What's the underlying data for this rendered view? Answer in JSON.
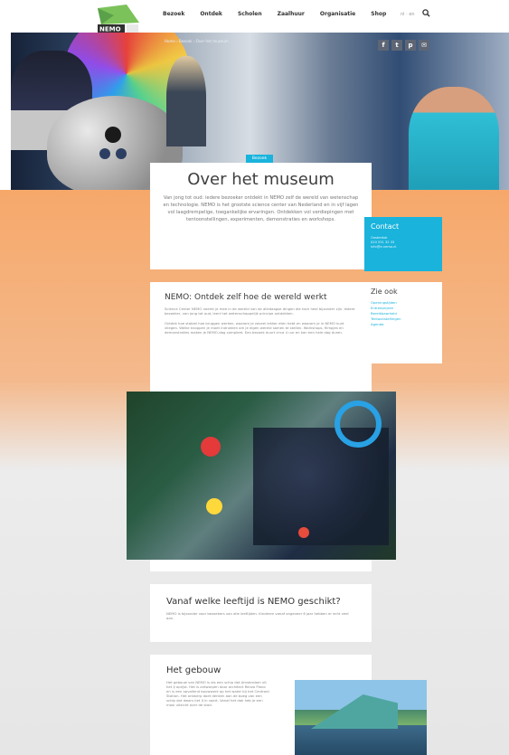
{
  "header": {
    "logo_text": "NEMO",
    "nav": [
      "Bezoek",
      "Ontdek",
      "Scholen",
      "Zaalhuur",
      "Organisatie",
      "Shop"
    ],
    "lang": "nl · en"
  },
  "hero": {
    "breadcrumb": "Home › Bezoek › Over het museum",
    "social": [
      "f",
      "t",
      "p",
      "✉"
    ]
  },
  "intro": {
    "tag": "Bezoek",
    "title": "Over het museum",
    "text": "Van jong tot oud: iedere bezoeker ontdekt in NEMO zelf de wereld van wetenschap en technologie. NEMO is het grootste science center van Nederland en in vijf lagen vol laagdrempelige, toegankelijke ervaringen. Ontdekken vol verdiepingen met tentoonstellingen, experimenten, demonstraties en workshops."
  },
  "contact": {
    "title": "Contact",
    "lines": [
      "Oosterdok",
      "020 531 32 33",
      "info@e-nemo.nl"
    ]
  },
  "zie_ook": {
    "title": "Zie ook",
    "items": [
      "Openingstijden",
      "Entreeprijzen",
      "Bereikbaarheid",
      "Tentoonstellingen",
      "Agenda"
    ]
  },
  "main": {
    "title": "NEMO: Ontdek zelf hoe de wereld werkt",
    "p1": "Science Center NEMO neemt je mee in de wereld van de alledaagse dingen die toch heel bijzonder zijn. Iedere bezoeker, van jong tot oud, leert het wetenschappelijk principe ontdekken.",
    "p2": "Ontdek hoe stabiel hoe bruggen werken, waarom je zoveel lekker eten hebt en waarom je in NEMO kunt vliegen. Welke knoppen je moet indrukken om je eigen wereld samen te stellen. Workshops, filmpjes en demonstraties maken je NEMO-dag compleet. Een bezoek duurt circa 4 uur en kan een hele dag duren."
  },
  "age": {
    "title": "Vanaf welke leeftijd is NEMO geschikt?",
    "text": "NEMO is bijzonder voor bezoekers van alle leeftijden. Kinderen vanaf ongeveer 6 jaar hebben er echt veel aan."
  },
  "gebouw": {
    "title": "Het gebouw",
    "text": "Het gebouw van NEMO is als een schip dat Amsterdam uit het IJ oprijst. Het is ontworpen door architect Renzo Piano en is een opvallend bouwwerk op het water bij het Centraal Station. Het ontwerp doet denken aan de boeg van een schip dat dwars het IJ in vaart. Vanaf het dak heb je een mooi uitzicht over de stad."
  }
}
